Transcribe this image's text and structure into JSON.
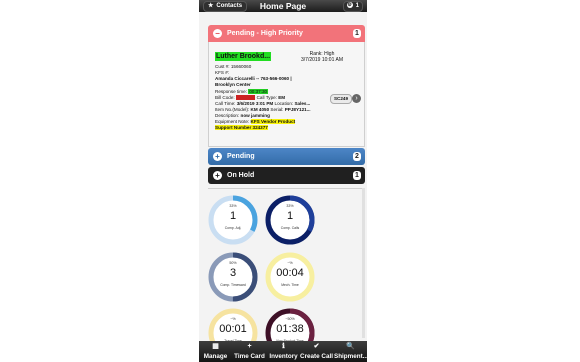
{
  "header": {
    "title": "Home Page",
    "contacts_label": "Contacts",
    "menu_label": "1"
  },
  "sections": {
    "high_priority": {
      "label": "Pending - High Priority",
      "count": "1"
    },
    "pending": {
      "label": "Pending",
      "count": "2"
    },
    "on_hold": {
      "label": "On Hold",
      "count": "1"
    }
  },
  "call_card": {
    "customer_name": "Luther Brookd...",
    "rank": "Rank: High",
    "rank_datetime": "3/7/2019 10:01 AM",
    "cust_no": "Cust #: 15660060",
    "kfs_label": "KFS #:",
    "contact_line": "Amanda Ciccarelli -- 763-566-0060 |",
    "location_line": "Brooklyn Center",
    "response_time_label": "Response time:",
    "response_time_value": "00:37:30",
    "bill_code_label": "Bill Code:",
    "bill_code_value": "Contract",
    "call_type_label": "Call Type:",
    "call_type_value": "EM",
    "call_time_label": "Call Time:",
    "call_time_value": "3/6/2019 3:01 PM",
    "location_label": "Location:",
    "location_value": "Sales...",
    "item_no_label": "Item No.(Model):",
    "item_no_value": "KM 4050",
    "serial_label": "Serial:",
    "serial_value": "PPJ8Y121...",
    "description_label": "Description:",
    "description_value": "now jamming",
    "equipment_note_label": "Equipment Note:",
    "equipment_note_value": "KFS Vendor Product",
    "support_number": "Support Number 324377",
    "tag": "SC249"
  },
  "gauges": [
    {
      "pct": "33%",
      "value": "1",
      "caption": "Comp. Adj.",
      "fill": 0.33,
      "color": "#4aa3df",
      "track": "#c9def2"
    },
    {
      "pct": "33%",
      "value": "1",
      "caption": "Comp. Calls",
      "fill": 0.33,
      "color": "#1f3f9a",
      "track": "#0b1f66"
    },
    {
      "pct": "50%",
      "value": "3",
      "caption": "Comp. Timeward",
      "fill": 0.5,
      "color": "#3b4e78",
      "track": "#8a9ab8"
    },
    {
      "pct": "~%",
      "value": "00:04",
      "caption": "Mech. Time",
      "fill": 0.0,
      "color": "#e8d84a",
      "track": "#f7efa0"
    },
    {
      "pct": "~%",
      "value": "00:01",
      "caption": "Travel Time",
      "fill": 0.0,
      "color": "#e8c84a",
      "track": "#f6e3a0"
    },
    {
      "pct": "~50%",
      "value": "01:38",
      "caption": "Non-Product Time",
      "fill": 0.5,
      "color": "#6b2140",
      "track": "#3d1026"
    }
  ],
  "navbar": [
    {
      "icon": "grid-icon",
      "glyph": "▦",
      "label": "Manage"
    },
    {
      "icon": "plus-icon",
      "glyph": "+",
      "label": "Time Card"
    },
    {
      "icon": "info-icon",
      "glyph": "ℹ",
      "label": "Inventory"
    },
    {
      "icon": "check-icon",
      "glyph": "✔",
      "label": "Create Call"
    },
    {
      "icon": "search-icon",
      "glyph": "🔍",
      "label": "Shipment..."
    }
  ]
}
